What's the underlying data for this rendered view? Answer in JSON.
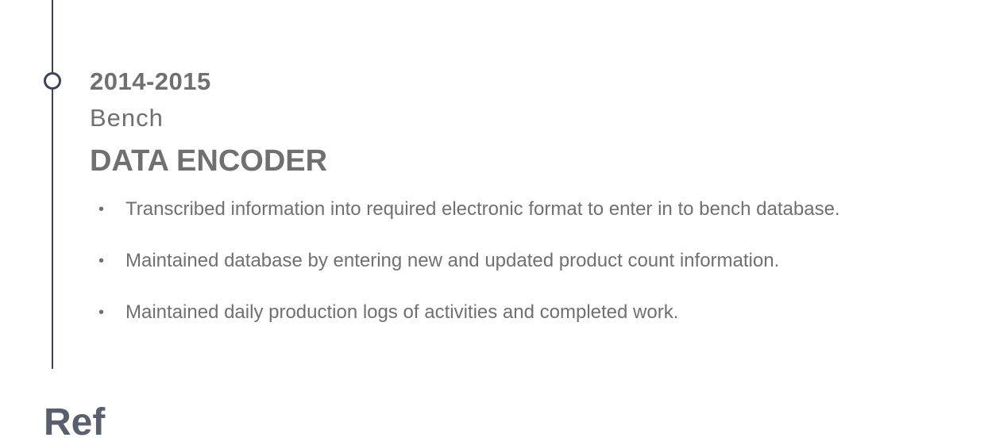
{
  "timeline": {
    "entries": [
      {
        "period": "2014-2015",
        "company": "Bench",
        "title": "DATA ENCODER",
        "duties": [
          "Transcribed information into required electronic format to enter in to bench database.",
          "Maintained database by entering new and updated product count information.",
          "Maintained daily production logs of activities and completed work."
        ]
      }
    ]
  },
  "next_section": {
    "heading": "Ref"
  },
  "colors": {
    "text": "#707070",
    "timeline": "#3f4455"
  }
}
